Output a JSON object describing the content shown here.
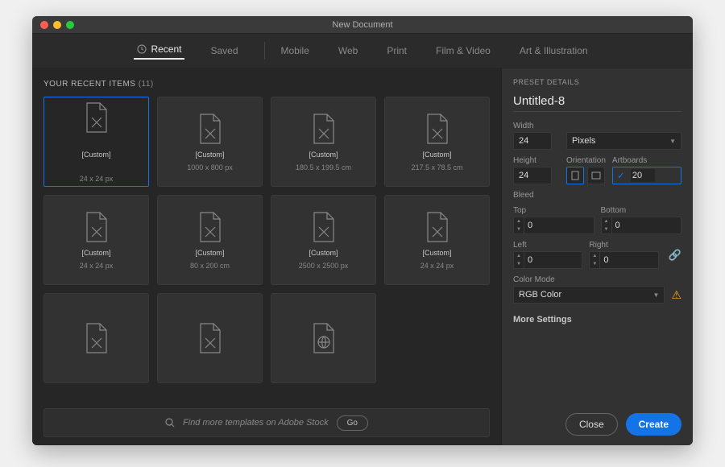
{
  "window": {
    "title": "New Document"
  },
  "tabs": {
    "recent": "Recent",
    "saved": "Saved",
    "mobile": "Mobile",
    "web": "Web",
    "print": "Print",
    "film": "Film & Video",
    "art": "Art & Illustration"
  },
  "section": {
    "title": "YOUR RECENT ITEMS",
    "count": "(11)"
  },
  "items": [
    {
      "name": "[Custom]",
      "dim": "24 x 24 px"
    },
    {
      "name": "[Custom]",
      "dim": "1000 x 800 px"
    },
    {
      "name": "[Custom]",
      "dim": "180.5 x 199.5 cm"
    },
    {
      "name": "[Custom]",
      "dim": "217.5 x 78.5 cm"
    },
    {
      "name": "[Custom]",
      "dim": "24 x 24 px"
    },
    {
      "name": "[Custom]",
      "dim": "80 x 200 cm"
    },
    {
      "name": "[Custom]",
      "dim": "2500 x 2500 px"
    },
    {
      "name": "[Custom]",
      "dim": "24 x 24 px"
    },
    {
      "name": "",
      "dim": ""
    },
    {
      "name": "",
      "dim": ""
    },
    {
      "name": "",
      "dim": ""
    }
  ],
  "stock": {
    "placeholder": "Find more templates on Adobe Stock",
    "go": "Go"
  },
  "preset": {
    "head": "PRESET DETAILS",
    "name": "Untitled-8",
    "widthLabel": "Width",
    "widthValue": "24",
    "unit": "Pixels",
    "heightLabel": "Height",
    "heightValue": "24",
    "orientLabel": "Orientation",
    "artboardsLabel": "Artboards",
    "artboardsValue": "20",
    "bleedLabel": "Bleed",
    "topLabel": "Top",
    "topValue": "0",
    "bottomLabel": "Bottom",
    "bottomValue": "0",
    "leftLabel": "Left",
    "leftValue": "0",
    "rightLabel": "Right",
    "rightValue": "0",
    "colorModeLabel": "Color Mode",
    "colorMode": "RGB Color",
    "more": "More Settings"
  },
  "buttons": {
    "close": "Close",
    "create": "Create"
  }
}
